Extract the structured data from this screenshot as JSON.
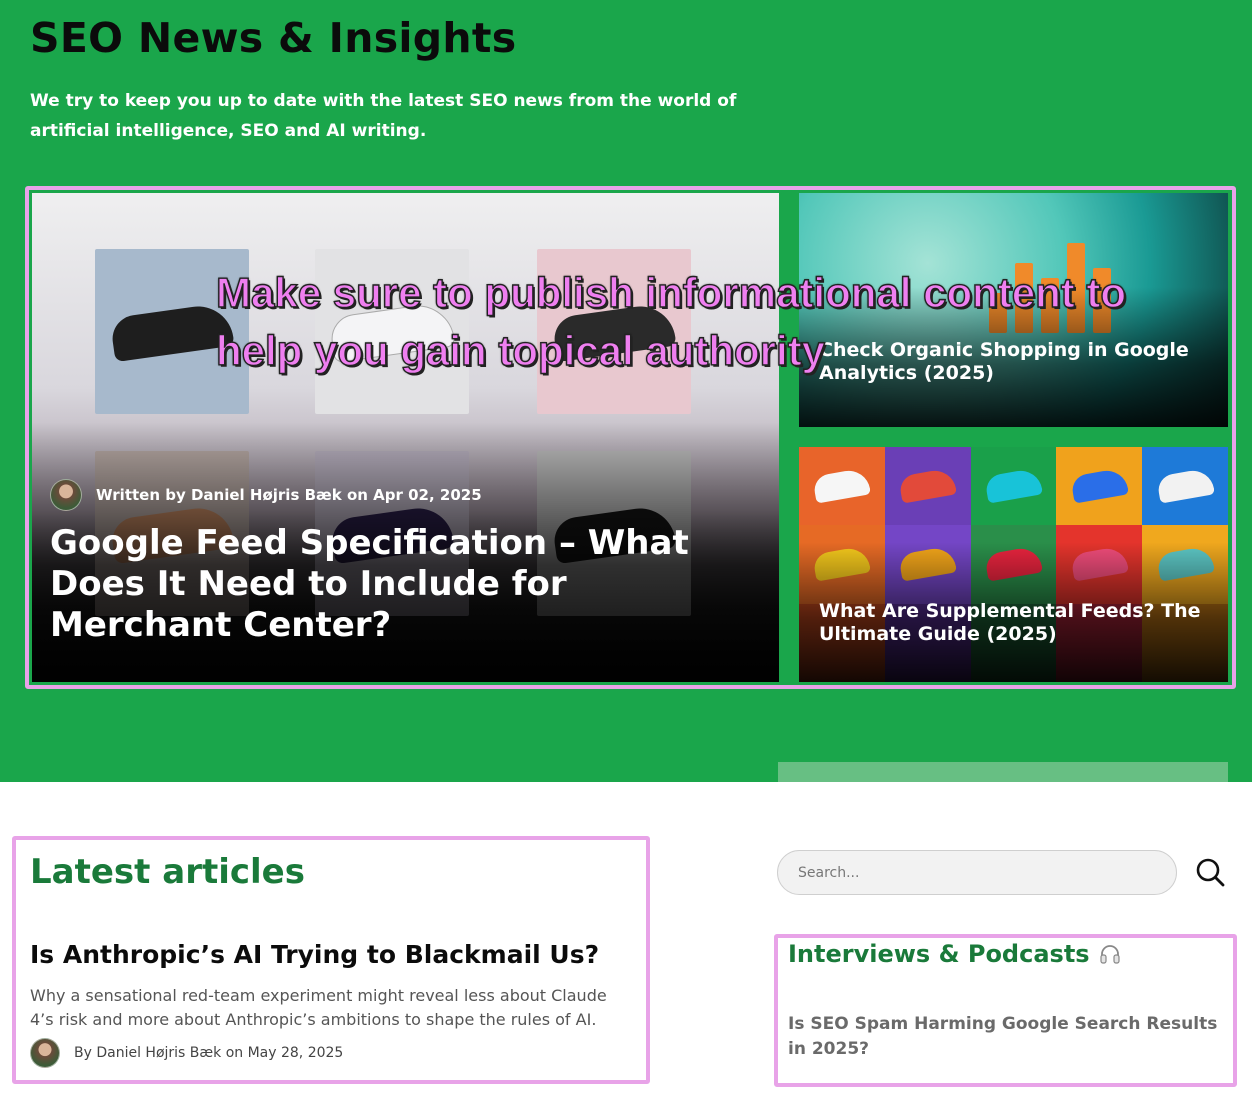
{
  "header": {
    "title": "SEO News & Insights",
    "intro": "We try to keep you up to date with the latest SEO news from the world of artificial intelligence, SEO and AI writing."
  },
  "featured": {
    "main": {
      "author_line": "Written by Daniel Højris Bæk on Apr 02, 2025",
      "title": "Google Feed Specification – What Does It Need to Include for Merchant Center?"
    },
    "side": [
      {
        "title": "Check Organic Shopping in Google Analytics (2025)"
      },
      {
        "title": "What Are Supplemental Feeds? The Ultimate Guide (2025)"
      }
    ]
  },
  "overlay_caption": "Make sure to publish informational content to help you gain topical authority",
  "latest": {
    "heading": "Latest articles",
    "article": {
      "title": "Is Anthropic’s AI Trying to Blackmail Us?",
      "excerpt": "Why a sensational red-team experiment might reveal less about Claude 4’s risk and more about Anthropic’s ambitions to shape the rules of AI.",
      "meta": "By Daniel Højris Bæk on May 28, 2025"
    }
  },
  "sidebar": {
    "search_placeholder": "Search...",
    "podcasts_heading": "Interviews & Podcasts",
    "podcast_link": "Is SEO Spam Harming Google Search Results in 2025?"
  },
  "colors": {
    "brand_green": "#1aa64b",
    "heading_green": "#1a7a3a",
    "highlight_pink": "#e8a3e8"
  }
}
